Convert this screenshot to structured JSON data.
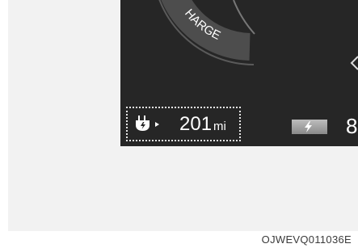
{
  "gauge": {
    "arc_label": "HARGE"
  },
  "range": {
    "value": "201",
    "unit": "mi"
  },
  "status": {
    "right_digit": "8"
  },
  "caption": "OJWEVQ011036E",
  "icons": {
    "plug": "ev-plug-icon",
    "charge": "lightning-icon"
  },
  "colors": {
    "panel": "#262626",
    "arc": "#4d4d4d",
    "text": "#ffffff"
  }
}
